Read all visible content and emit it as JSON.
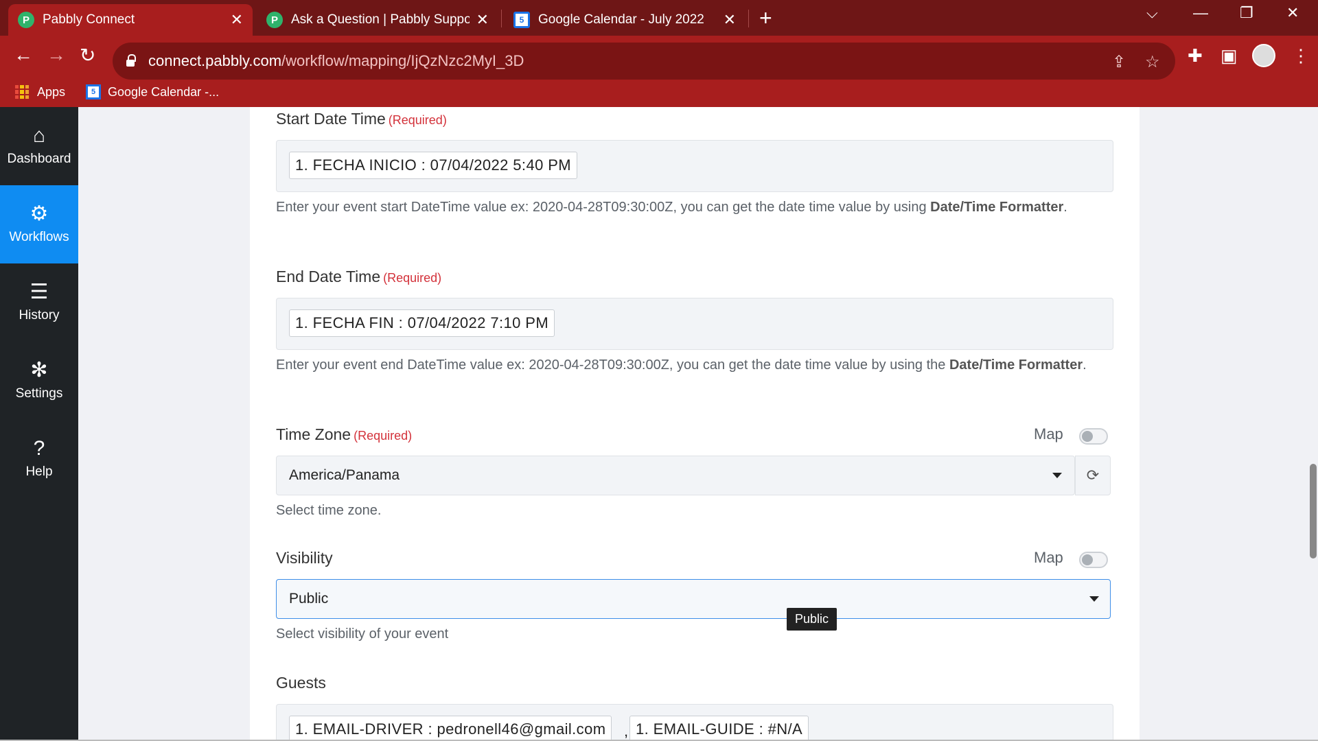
{
  "browser": {
    "tabs": [
      {
        "title": "Pabbly Connect",
        "favicon": "pabbly-p-icon",
        "active": true
      },
      {
        "title": "Ask a Question | Pabbly Support",
        "favicon": "pabbly-p-icon",
        "active": false
      },
      {
        "title": "Google Calendar - July 2022",
        "favicon": "google-calendar-icon",
        "active": false
      }
    ],
    "favicon_letter": "P",
    "calendar_day": "5",
    "url_host": "connect.pabbly.com",
    "url_path": "/workflow/mapping/IjQzNzc2MyI_3D",
    "bookmarks": [
      {
        "label": "Apps",
        "icon": "apps-grid-icon"
      },
      {
        "label": "Google Calendar -...",
        "icon": "google-calendar-icon"
      }
    ],
    "theme_color": "#a81e1e"
  },
  "sidebar": {
    "items": [
      {
        "label": "Dashboard",
        "icon": "home-icon",
        "active": false
      },
      {
        "label": "Workflows",
        "icon": "workflow-icon",
        "active": true
      },
      {
        "label": "History",
        "icon": "list-icon",
        "active": false
      },
      {
        "label": "Settings",
        "icon": "gear-icon",
        "active": false
      },
      {
        "label": "Help",
        "icon": "question-icon",
        "active": false
      }
    ]
  },
  "form": {
    "required_text": "(Required)",
    "map_label": "Map",
    "start": {
      "label": "Start Date Time",
      "chip": "1. FECHA INICIO : 07/04/2022 5:40 PM",
      "help_prefix": "Enter your event start DateTime value ex: 2020-04-28T09:30:00Z, you can get the date time value by using ",
      "help_bold": "Date/Time Formatter",
      "help_suffix": "."
    },
    "end": {
      "label": "End Date Time",
      "chip": "1. FECHA FIN : 07/04/2022 7:10 PM",
      "help_prefix": "Enter your event end DateTime value ex: 2020-04-28T09:30:00Z, you can get the date time value by using the ",
      "help_bold": "Date/Time Formatter",
      "help_suffix": "."
    },
    "timezone": {
      "label": "Time Zone",
      "value": "America/Panama",
      "help": "Select time zone.",
      "map_enabled": false
    },
    "visibility": {
      "label": "Visibility",
      "value": "Public",
      "help": "Select visibility of your event",
      "tooltip": "Public",
      "map_enabled": false
    },
    "guests": {
      "label": "Guests",
      "chips": [
        "1. EMAIL-DRIVER : pedronell46@gmail.com",
        "1. EMAIL-GUIDE : #N/A"
      ],
      "separator": ","
    }
  }
}
